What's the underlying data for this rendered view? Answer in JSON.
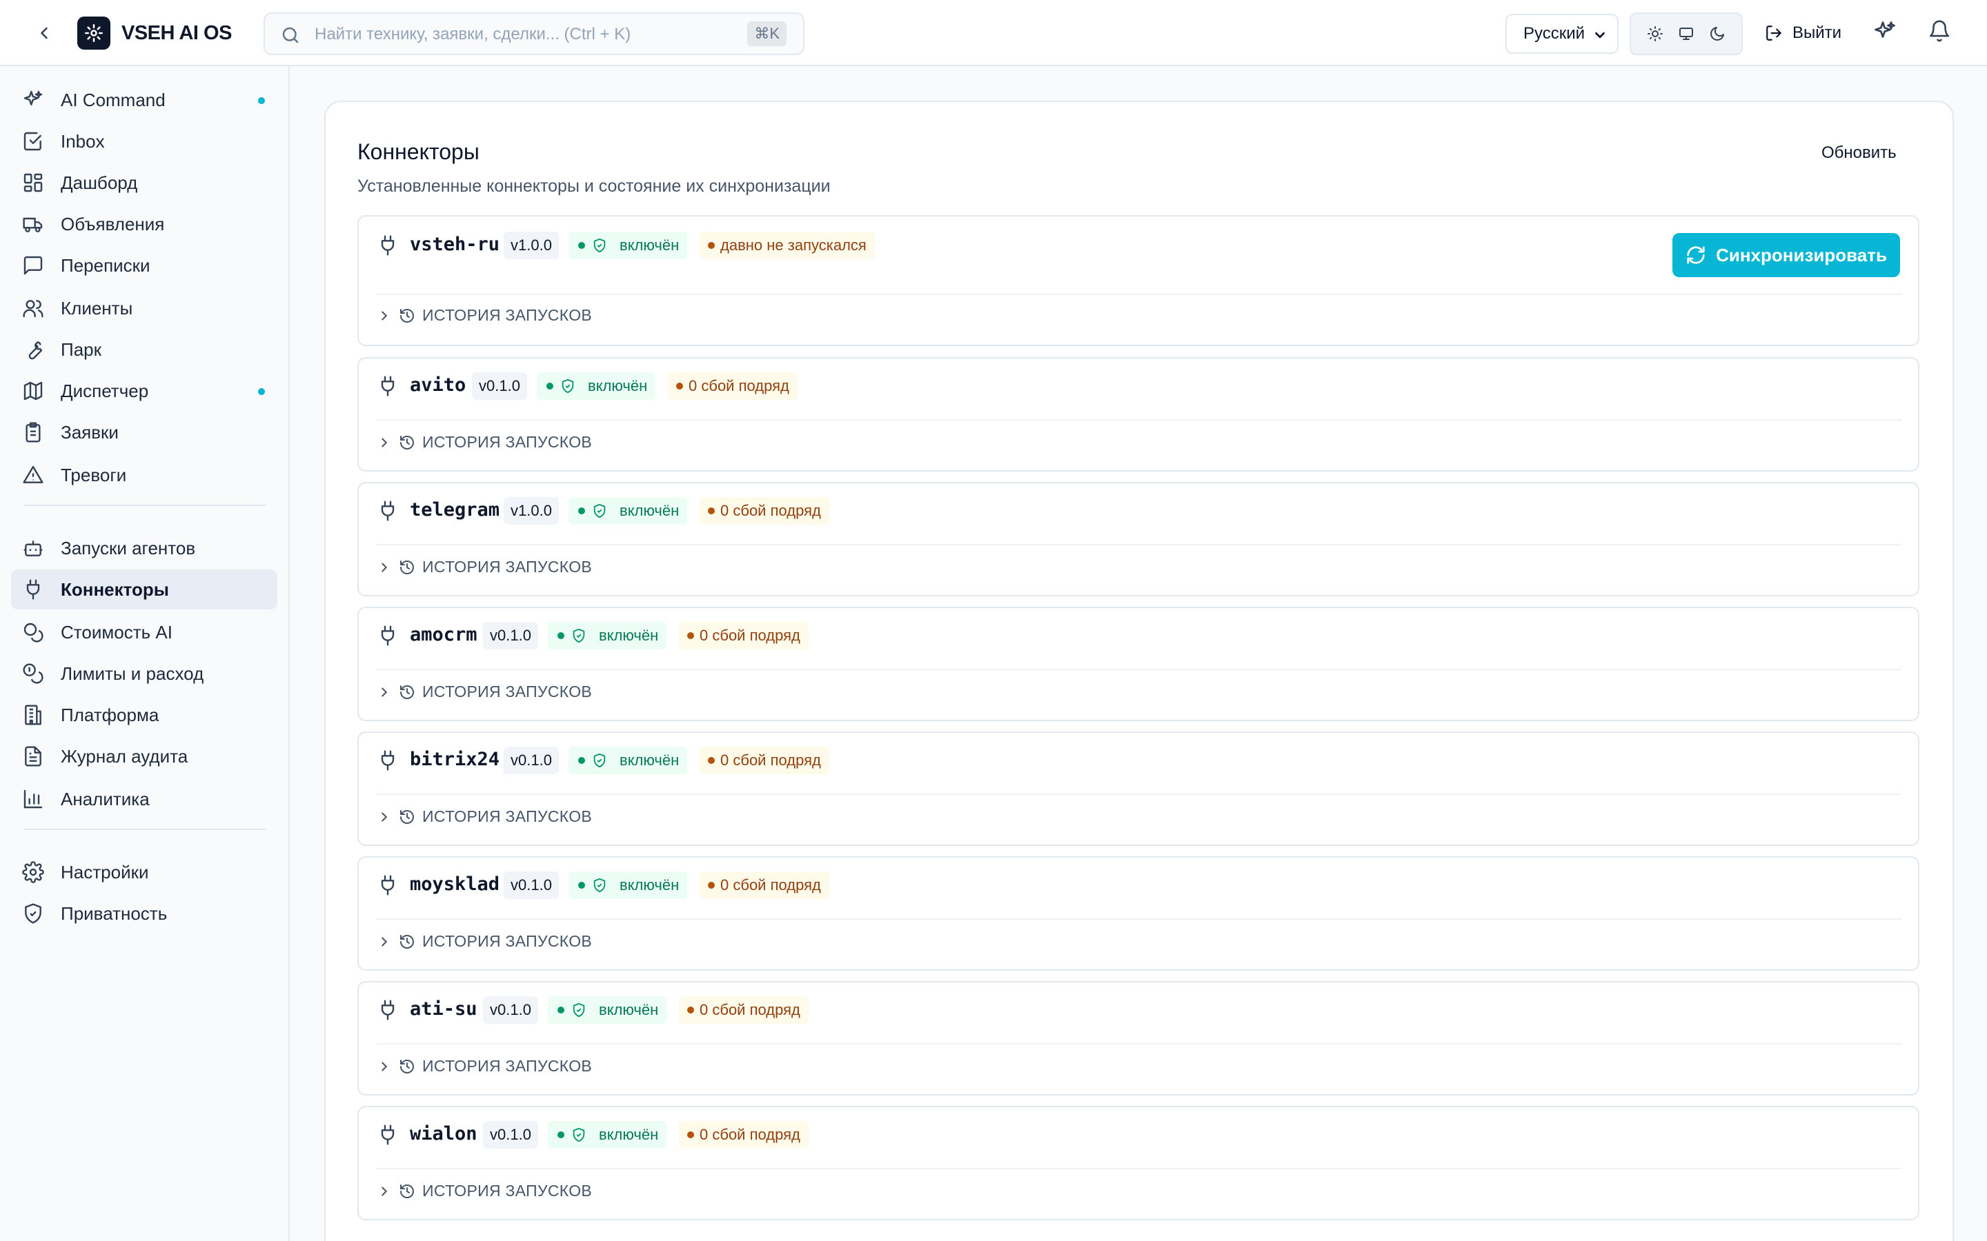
{
  "app": {
    "title": "VSEH AI OS"
  },
  "search": {
    "placeholder": "Найти технику, заявки, сделки... (Ctrl + K)",
    "shortcut": "⌘K"
  },
  "header": {
    "language": "Русский",
    "logout_label": "Выйти"
  },
  "sidebar": {
    "items": [
      {
        "label": "AI Command",
        "icon": "sparkles-icon",
        "dot": true
      },
      {
        "label": "Inbox",
        "icon": "inbox-check-icon"
      },
      {
        "label": "Дашборд",
        "icon": "dashboard-icon"
      },
      {
        "label": "Объявления",
        "icon": "truck-icon"
      },
      {
        "label": "Переписки",
        "icon": "message-icon"
      },
      {
        "label": "Клиенты",
        "icon": "users-icon"
      },
      {
        "label": "Парк",
        "icon": "wrench-icon"
      },
      {
        "label": "Диспетчер",
        "icon": "map-icon",
        "dot": true
      },
      {
        "label": "Заявки",
        "icon": "clipboard-icon"
      },
      {
        "label": "Тревоги",
        "icon": "alert-triangle-icon"
      },
      {
        "label": "Запуски агентов",
        "icon": "bot-icon"
      },
      {
        "label": "Коннекторы",
        "icon": "plug-icon",
        "active": true
      },
      {
        "label": "Стоимость AI",
        "icon": "coins-icon"
      },
      {
        "label": "Лимиты и расход",
        "icon": "coins-stack-icon"
      },
      {
        "label": "Платформа",
        "icon": "building-icon"
      },
      {
        "label": "Журнал аудита",
        "icon": "document-icon"
      },
      {
        "label": "Аналитика",
        "icon": "bar-chart-icon"
      },
      {
        "label": "Настройки",
        "icon": "gear-icon"
      },
      {
        "label": "Приватность",
        "icon": "shield-check-icon"
      }
    ]
  },
  "page": {
    "title": "Коннекторы",
    "subtitle": "Установленные коннекторы и состояние их синхронизации",
    "refresh_label": "Обновить",
    "sync_label": "Синхронизировать",
    "history_label": "ИСТОРИЯ ЗАПУСКОВ"
  },
  "connectors": [
    {
      "name": "vsteh-ru",
      "version": "v1.0.0",
      "status": "включён",
      "health": "давно не запускался"
    },
    {
      "name": "avito",
      "version": "v0.1.0",
      "status": "включён",
      "health": "0 сбой подряд"
    },
    {
      "name": "telegram",
      "version": "v1.0.0",
      "status": "включён",
      "health": "0 сбой подряд"
    },
    {
      "name": "amocrm",
      "version": "v0.1.0",
      "status": "включён",
      "health": "0 сбой подряд"
    },
    {
      "name": "bitrix24",
      "version": "v0.1.0",
      "status": "включён",
      "health": "0 сбой подряд"
    },
    {
      "name": "moysklad",
      "version": "v0.1.0",
      "status": "включён",
      "health": "0 сбой подряд"
    },
    {
      "name": "ati-su",
      "version": "v0.1.0",
      "status": "включён",
      "health": "0 сбой подряд"
    },
    {
      "name": "wialon",
      "version": "v0.1.0",
      "status": "включён",
      "health": "0 сбой подряд"
    }
  ],
  "colors": {
    "accent": "#06b6d4",
    "ok": "#047857",
    "warn": "#92400e"
  }
}
